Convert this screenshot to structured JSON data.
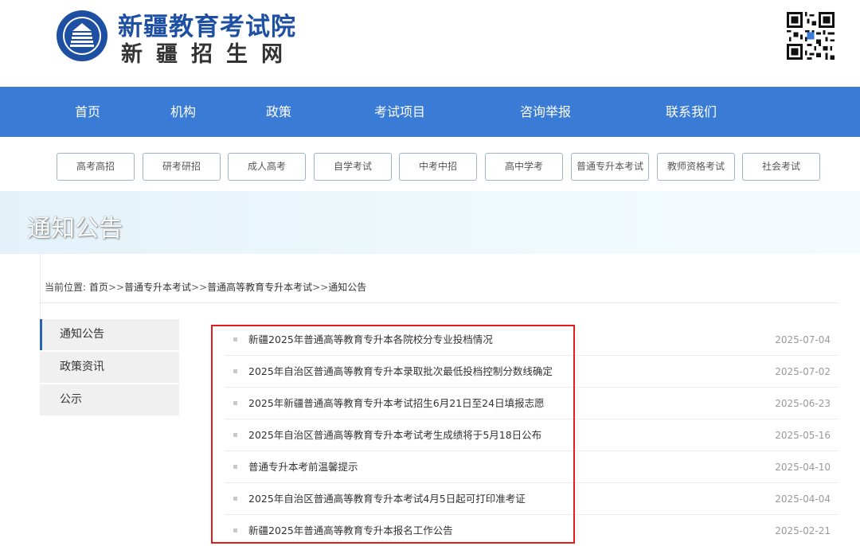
{
  "header": {
    "title": "新疆教育考试院",
    "subtitle": "新疆招生网"
  },
  "main_nav": [
    {
      "label": "首页"
    },
    {
      "label": "机构"
    },
    {
      "label": "政策"
    },
    {
      "label": "考试项目"
    },
    {
      "label": "咨询举报"
    },
    {
      "label": "联系我们"
    }
  ],
  "categories": [
    {
      "label": "高考高招"
    },
    {
      "label": "研考研招"
    },
    {
      "label": "成人高考"
    },
    {
      "label": "自学考试"
    },
    {
      "label": "中考中招"
    },
    {
      "label": "高中学考"
    },
    {
      "label": "普通专升本考试"
    },
    {
      "label": "教师资格考试"
    },
    {
      "label": "社会考试"
    }
  ],
  "banner": {
    "title": "通知公告"
  },
  "breadcrumb": {
    "prefix": "当前位置:",
    "items": [
      {
        "label": "首页"
      },
      {
        "label": "普通专升本考试"
      },
      {
        "label": "普通高等教育专升本考试"
      },
      {
        "label": "通知公告"
      }
    ],
    "separator": ">>"
  },
  "sidebar": {
    "items": [
      {
        "label": "通知公告",
        "active": true
      },
      {
        "label": "政策资讯",
        "active": false
      },
      {
        "label": "公示",
        "active": false
      }
    ]
  },
  "news": [
    {
      "title": "新疆2025年普通高等教育专升本各院校分专业投档情况",
      "date": "2025-07-04"
    },
    {
      "title": "2025年自治区普通高等教育专升本录取批次最低投档控制分数线确定",
      "date": "2025-07-02"
    },
    {
      "title": "2025年新疆普通高等教育专升本考试招生6月21日至24日填报志愿",
      "date": "2025-06-23"
    },
    {
      "title": "2025年自治区普通高等教育专升本考试考生成绩将于5月18日公布",
      "date": "2025-05-16"
    },
    {
      "title": "普通专升本考前温馨提示",
      "date": "2025-04-10"
    },
    {
      "title": "2025年自治区普通高等教育专升本考试4月5日起可打印准考证",
      "date": "2025-04-04"
    },
    {
      "title": "新疆2025年普通高等教育专升本报名工作公告",
      "date": "2025-02-21"
    }
  ],
  "colors": {
    "nav_bg": "#3a7bd5",
    "brand_blue": "#1d4fa3",
    "highlight_border": "#e31d1d"
  },
  "icons": {
    "logo": "exam-institute-emblem-icon",
    "qr": "qr-code-icon",
    "bullet": "square-bullet-icon"
  }
}
